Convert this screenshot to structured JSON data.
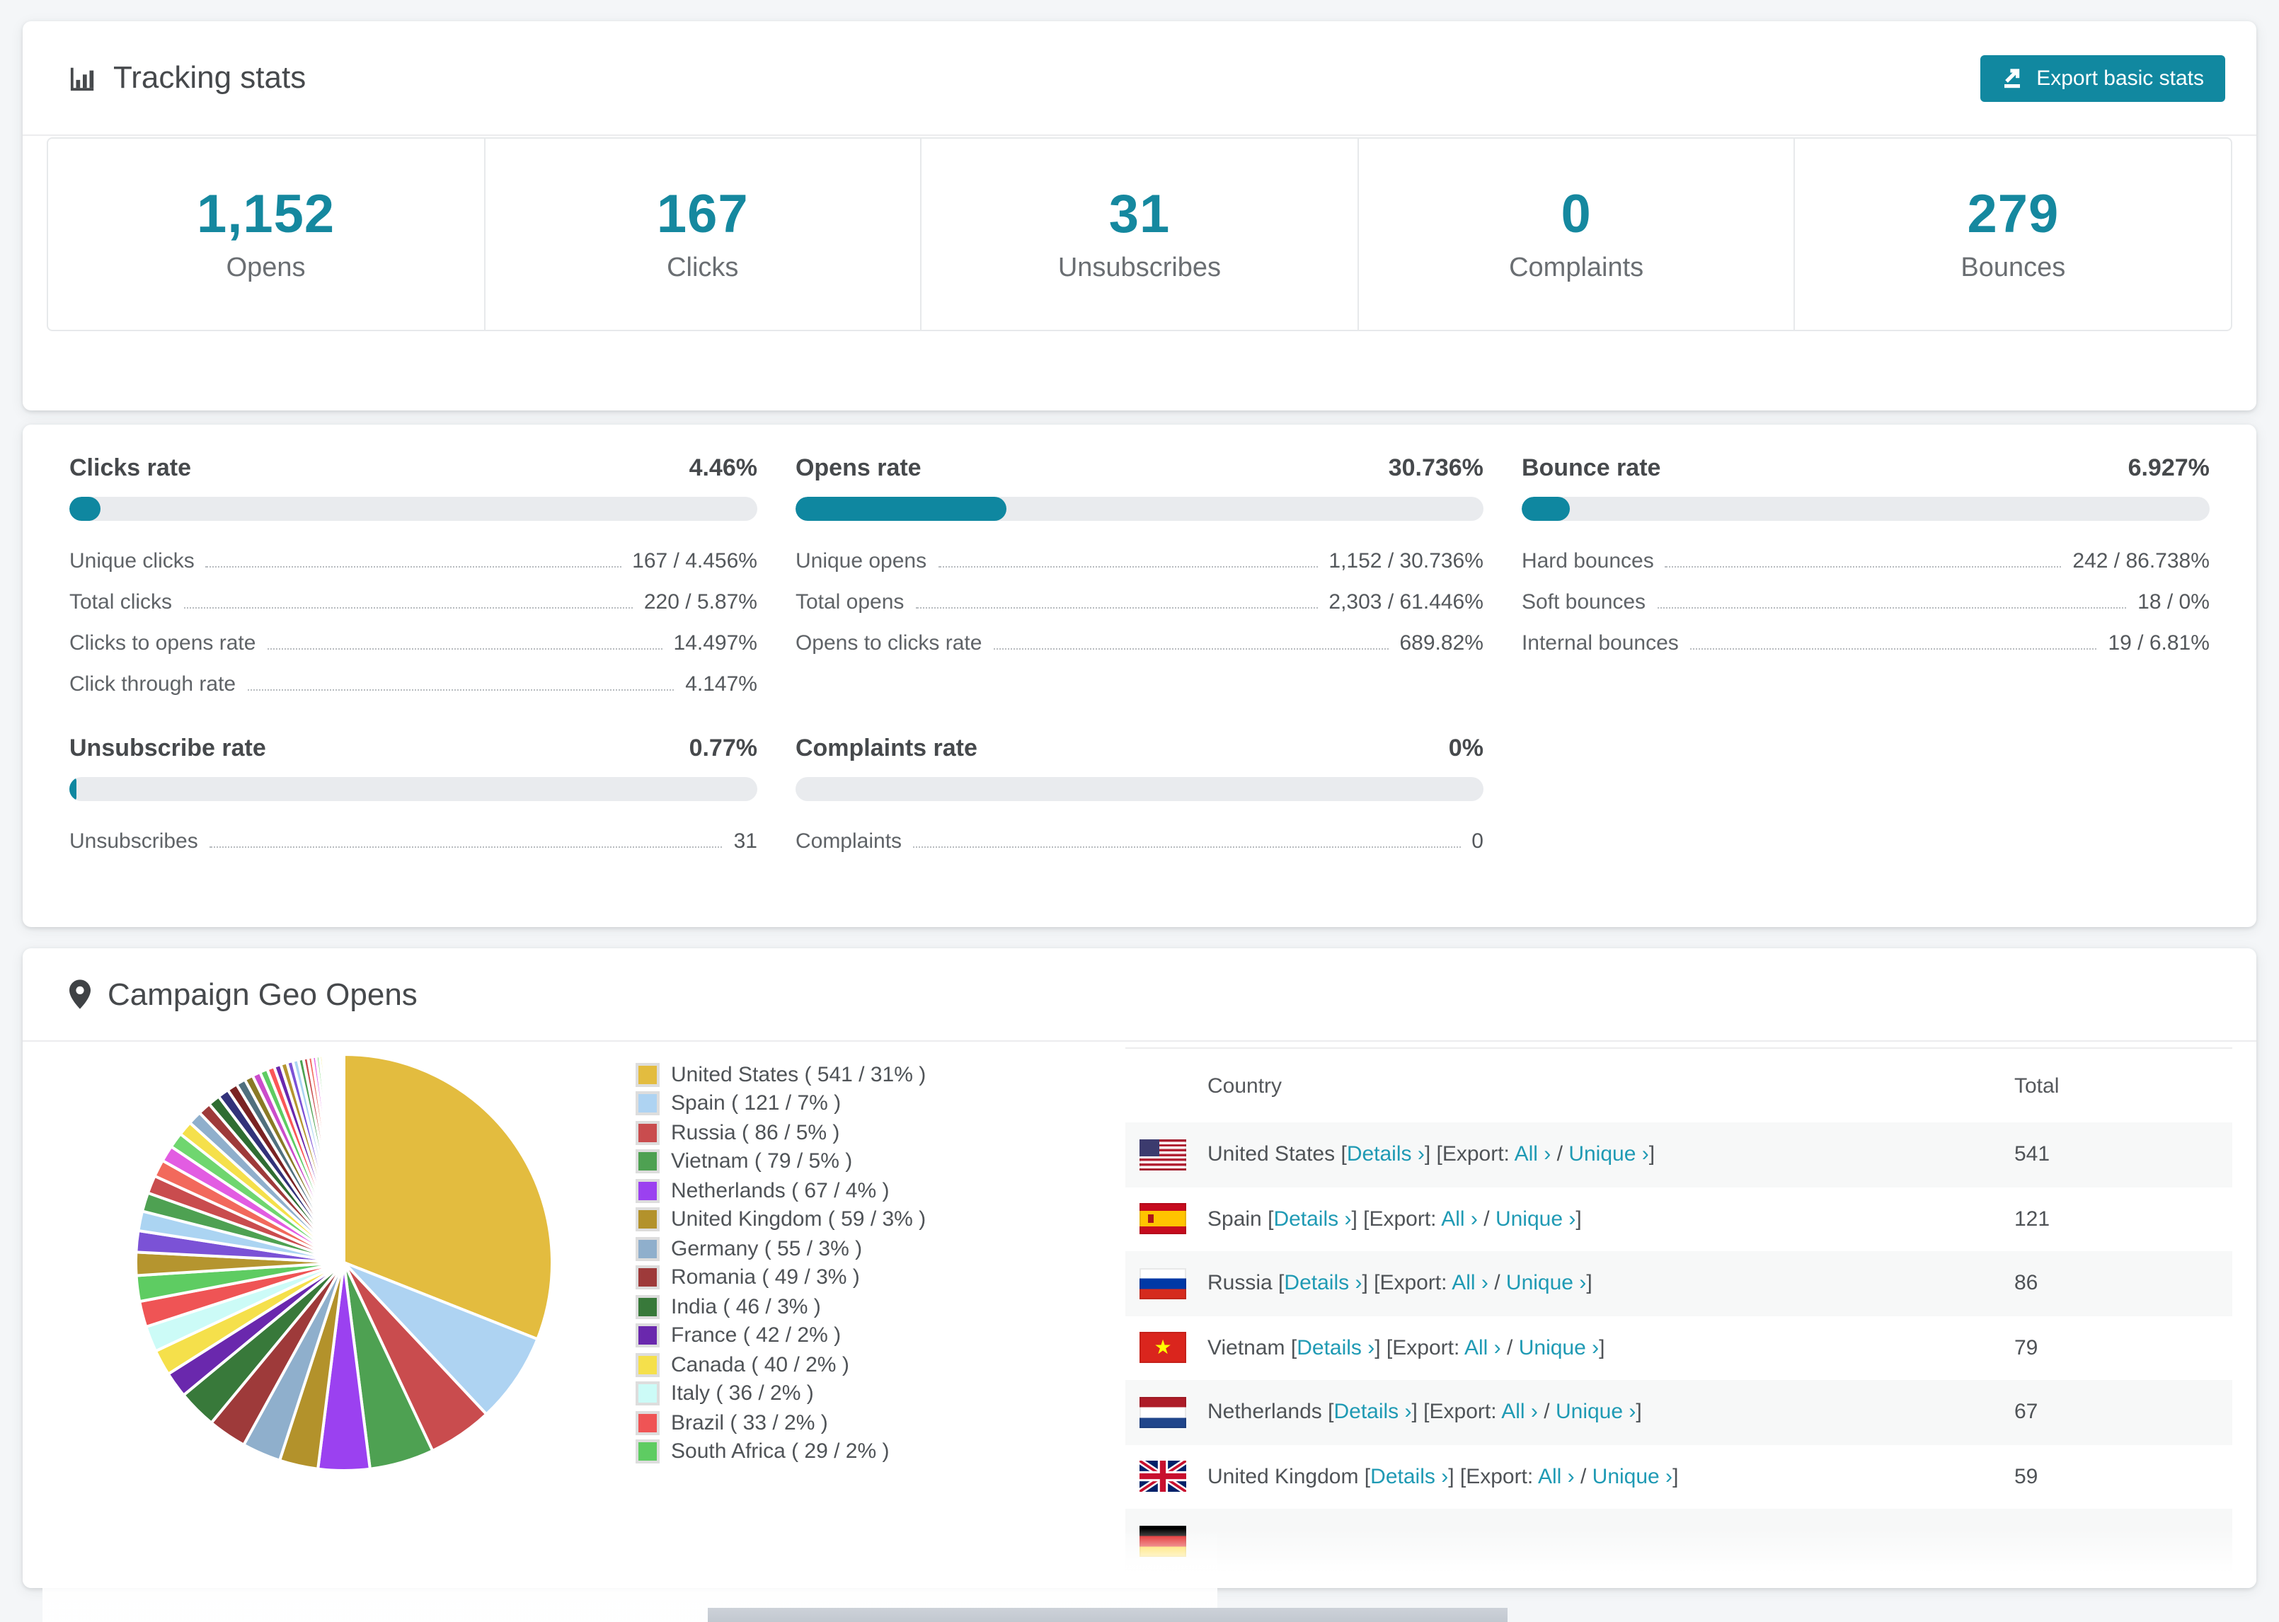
{
  "colors": {
    "accent": "#1188a0",
    "accent_fill": "#0f87a0",
    "link": "#1f9ab4",
    "stat_number": "#15889f",
    "bar_track": "#e9ebee",
    "row_stripe": "#f7f8f8"
  },
  "tracking": {
    "title": "Tracking stats",
    "export_button": "Export basic stats",
    "stats": [
      {
        "value": "1,152",
        "label": "Opens"
      },
      {
        "value": "167",
        "label": "Clicks"
      },
      {
        "value": "31",
        "label": "Unsubscribes"
      },
      {
        "value": "0",
        "label": "Complaints"
      },
      {
        "value": "279",
        "label": "Bounces"
      }
    ]
  },
  "rates": {
    "row1": [
      {
        "title": "Clicks rate",
        "value": "4.46%",
        "percent": 4.46,
        "rows": [
          {
            "label": "Unique clicks",
            "value": "167 / 4.456%"
          },
          {
            "label": "Total clicks",
            "value": "220 / 5.87%"
          },
          {
            "label": "Clicks to opens rate",
            "value": "14.497%"
          },
          {
            "label": "Click through rate",
            "value": "4.147%"
          }
        ]
      },
      {
        "title": "Opens rate",
        "value": "30.736%",
        "percent": 30.736,
        "rows": [
          {
            "label": "Unique opens",
            "value": "1,152 / 30.736%"
          },
          {
            "label": "Total opens",
            "value": "2,303 / 61.446%"
          },
          {
            "label": "Opens to clicks rate",
            "value": "689.82%"
          }
        ]
      },
      {
        "title": "Bounce rate",
        "value": "6.927%",
        "percent": 6.927,
        "rows": [
          {
            "label": "Hard bounces",
            "value": "242 / 86.738%"
          },
          {
            "label": "Soft bounces",
            "value": "18 / 0%"
          },
          {
            "label": "Internal bounces",
            "value": "19 / 6.81%"
          }
        ]
      }
    ],
    "row2": [
      {
        "title": "Unsubscribe rate",
        "value": "0.77%",
        "percent": 0.77,
        "rows": [
          {
            "label": "Unsubscribes",
            "value": "31"
          }
        ]
      },
      {
        "title": "Complaints rate",
        "value": "0%",
        "percent": 0,
        "rows": [
          {
            "label": "Complaints",
            "value": "0"
          }
        ]
      }
    ]
  },
  "geo": {
    "title": "Campaign Geo Opens",
    "legend": [
      {
        "label": "United States ( 541 / 31% )",
        "color": "#e3bc3f"
      },
      {
        "label": "Spain ( 121 / 7% )",
        "color": "#aed3f2"
      },
      {
        "label": "Russia ( 86 / 5% )",
        "color": "#c94c4e"
      },
      {
        "label": "Vietnam ( 79 / 5% )",
        "color": "#4ea152"
      },
      {
        "label": "Netherlands ( 67 / 4% )",
        "color": "#9b41f0"
      },
      {
        "label": "United Kingdom ( 59 / 3% )",
        "color": "#b3922b"
      },
      {
        "label": "Germany ( 55 / 3% )",
        "color": "#8fafcc"
      },
      {
        "label": "Romania ( 49 / 3% )",
        "color": "#9e3a3a"
      },
      {
        "label": "India ( 46 / 3% )",
        "color": "#38793a"
      },
      {
        "label": "France ( 42 / 2% )",
        "color": "#6a28ad"
      },
      {
        "label": "Canada ( 40 / 2% )",
        "color": "#f5e04b"
      },
      {
        "label": "Italy ( 36 / 2% )",
        "color": "#ccfbf7"
      },
      {
        "label": "Brazil ( 33 / 2% )",
        "color": "#ef5455"
      },
      {
        "label": "South Africa ( 29 / 2% )",
        "color": "#5ecc62"
      }
    ],
    "chart_data": {
      "type": "pie",
      "title": "Campaign Geo Opens",
      "labels": [
        "United States",
        "Spain",
        "Russia",
        "Vietnam",
        "Netherlands",
        "United Kingdom",
        "Germany",
        "Romania",
        "India",
        "France",
        "Canada",
        "Italy",
        "Brazil",
        "South Africa"
      ],
      "values": [
        541,
        121,
        86,
        79,
        67,
        59,
        55,
        49,
        46,
        42,
        40,
        36,
        33,
        29
      ],
      "percents": [
        31,
        7,
        5,
        5,
        4,
        3,
        3,
        3,
        3,
        2,
        2,
        2,
        2,
        2
      ],
      "colors": [
        "#e3bc3f",
        "#aed3f2",
        "#c94c4e",
        "#4ea152",
        "#9b41f0",
        "#b3922b",
        "#8fafcc",
        "#9e3a3a",
        "#38793a",
        "#6a28ad",
        "#f5e04b",
        "#ccfbf7",
        "#ef5455",
        "#5ecc62"
      ],
      "legend_position": "right",
      "tail": {
        "percent": 26,
        "weights": [
          27,
          25,
          23,
          22,
          21,
          20,
          19,
          18,
          17,
          16,
          15,
          14,
          13,
          12,
          11,
          10,
          9.5,
          9,
          8.5,
          8,
          7.5,
          7,
          6.5,
          6,
          5.5,
          5,
          4.5,
          4,
          3.6,
          3.2,
          2.8,
          2.5,
          2.2,
          2,
          1.8,
          1.6,
          1.4,
          1.2,
          1,
          0.9,
          0.8,
          0.7,
          0.6,
          0.5,
          0.45,
          0.4,
          0.35,
          0.3
        ],
        "palette": [
          "#b5952f",
          "#7b52d6",
          "#abd4f2",
          "#4ea152",
          "#c94c4e",
          "#f2695c",
          "#e25ce2",
          "#6fd66f",
          "#f5e04b",
          "#8fafcc",
          "#9e3a3a",
          "#2f6d32",
          "#32327a",
          "#7a2323",
          "#50707e",
          "#8a7a26",
          "#cb4ccb",
          "#5ecc62",
          "#fa5757",
          "#6a28ad"
        ]
      }
    },
    "table": {
      "columns": [
        "Country",
        "Total"
      ],
      "details_label": "Details ›",
      "export_prefix": "[Export: ",
      "all_label": "All ›",
      "separator": " / ",
      "unique_label": "Unique ›",
      "rows": [
        {
          "country": "United States",
          "flag": "us",
          "total": "541"
        },
        {
          "country": "Spain",
          "flag": "es",
          "total": "121"
        },
        {
          "country": "Russia",
          "flag": "ru",
          "total": "86"
        },
        {
          "country": "Vietnam",
          "flag": "vn",
          "total": "79"
        },
        {
          "country": "Netherlands",
          "flag": "nl",
          "total": "67"
        },
        {
          "country": "United Kingdom",
          "flag": "gb",
          "total": "59"
        },
        {
          "country": "",
          "flag": "de",
          "total": ""
        }
      ]
    }
  }
}
